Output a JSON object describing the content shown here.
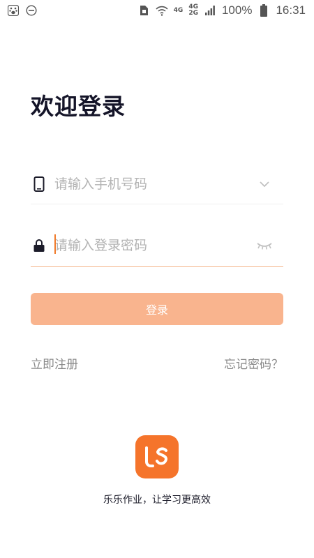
{
  "status_bar": {
    "network_top": "4G",
    "network_secondary_top": "4G",
    "network_secondary_bottom": "2G",
    "battery_percent": "100%",
    "time": "16:31",
    "icons": [
      "baidu-paw-icon",
      "do-not-disturb-icon",
      "sim-icon",
      "wifi-icon",
      "signal-icon",
      "battery-icon"
    ]
  },
  "login": {
    "title": "欢迎登录",
    "phone_placeholder": "请输入手机号码",
    "password_placeholder": "请输入登录密码",
    "submit_label": "登录",
    "register_link": "立即注册",
    "forgot_link": "忘记密码？"
  },
  "branding": {
    "slogan": "乐乐作业，让学习更高效",
    "accent_color": "#f5742b",
    "button_color": "#f9b48e"
  }
}
